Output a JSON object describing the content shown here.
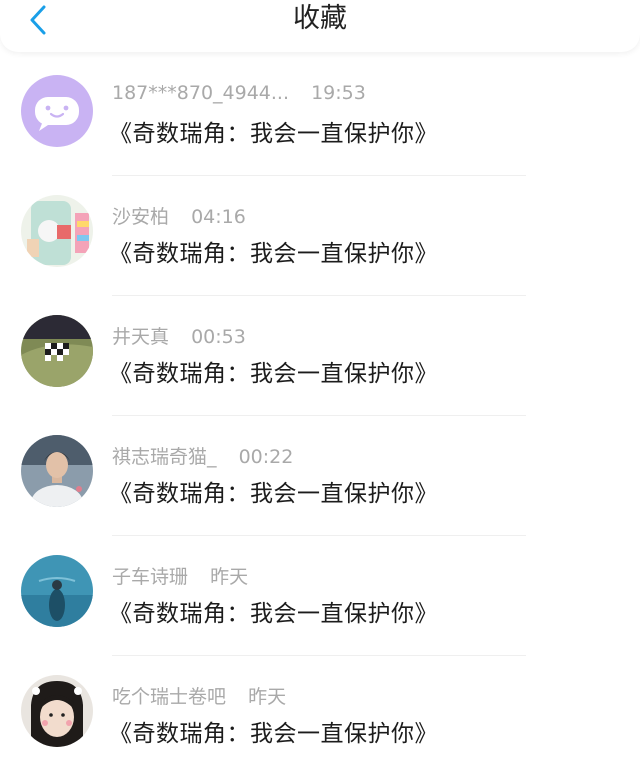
{
  "header": {
    "title": "收藏",
    "back_icon": "chevron-left-icon",
    "accent_color": "#1a9fe8"
  },
  "items": [
    {
      "name": "187***870_4944...",
      "time": "19:53",
      "message": "《奇数瑞角：我会一直保护你》"
    },
    {
      "name": "沙安柏",
      "time": "04:16",
      "message": "《奇数瑞角：我会一直保护你》"
    },
    {
      "name": "井天真",
      "time": "00:53",
      "message": "《奇数瑞角：我会一直保护你》"
    },
    {
      "name": "祺志瑞奇猫_",
      "time": "00:22",
      "message": "《奇数瑞角：我会一直保护你》"
    },
    {
      "name": "子车诗珊",
      "time": "昨天",
      "message": "《奇数瑞角：我会一直保护你》"
    },
    {
      "name": "吃个瑞士卷吧",
      "time": "昨天",
      "message": "《奇数瑞角：我会一直保护你》"
    }
  ]
}
